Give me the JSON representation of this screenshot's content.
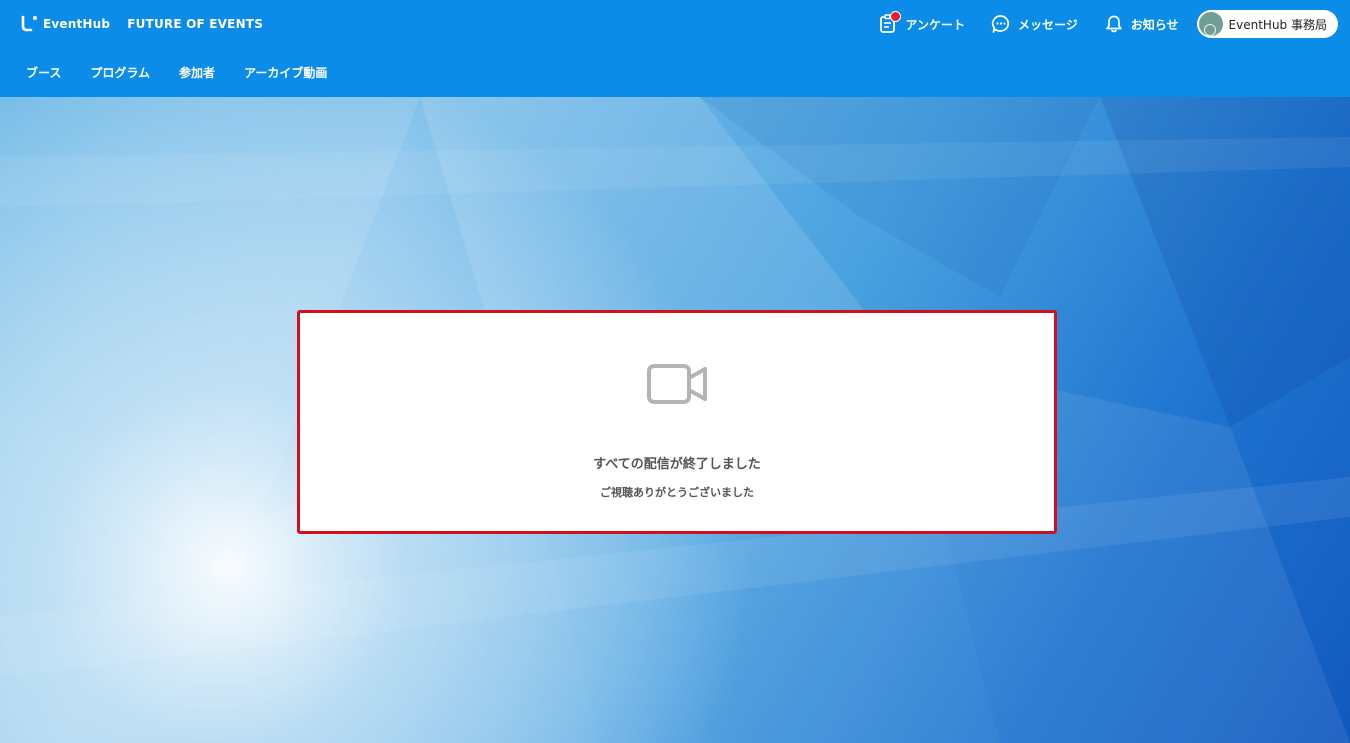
{
  "header": {
    "logo_text": "EventHub",
    "event_name": "FUTURE OF EVENTS",
    "actions": [
      {
        "label": "アンケート",
        "icon": "survey-icon",
        "has_notification": true
      },
      {
        "label": "メッセージ",
        "icon": "chat-icon",
        "has_notification": false
      },
      {
        "label": "お知らせ",
        "icon": "bell-icon",
        "has_notification": false
      }
    ],
    "user": {
      "name": "EventHub 事務局"
    }
  },
  "nav": {
    "items": [
      {
        "label": "ブース"
      },
      {
        "label": "プログラム"
      },
      {
        "label": "参加者"
      },
      {
        "label": "アーカイブ動画"
      }
    ]
  },
  "stream_card": {
    "icon": "video-camera-icon",
    "title": "すべての配信が終了しました",
    "subtitle": "ご視聴ありがとうございました"
  },
  "colors": {
    "header_bg": "#0a8ce8",
    "highlight_border": "#d0101a",
    "notification_dot": "#e4202c"
  }
}
